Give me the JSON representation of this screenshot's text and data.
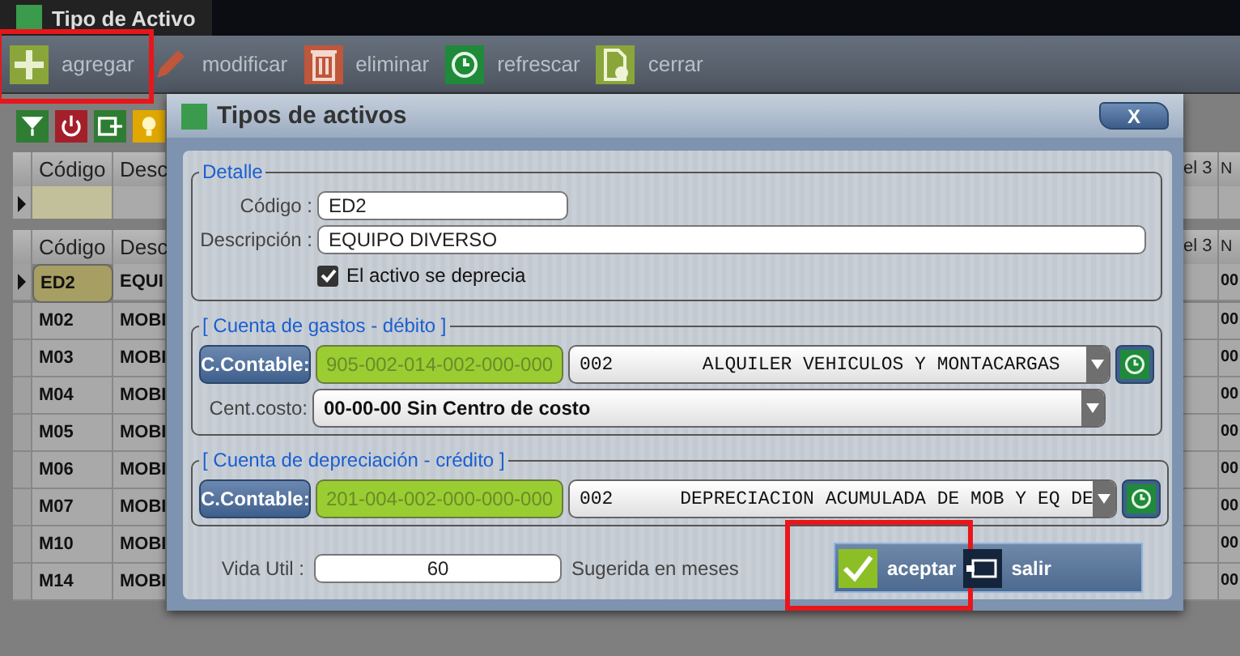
{
  "window": {
    "tab": "Tipo de Activo"
  },
  "toolbar": [
    {
      "kind": "add",
      "label": "agregar",
      "highlighted": true
    },
    {
      "kind": "edit",
      "label": "modificar",
      "highlighted": false
    },
    {
      "kind": "delete",
      "label": "eliminar",
      "highlighted": false
    },
    {
      "kind": "refresh",
      "label": "refrescar",
      "highlighted": false
    },
    {
      "kind": "close",
      "label": "cerrar",
      "highlighted": false
    }
  ],
  "grid_tools": [
    {
      "kind": "filter"
    },
    {
      "kind": "power"
    },
    {
      "kind": "export"
    },
    {
      "kind": "bulb"
    }
  ],
  "filter_header": [
    "Código",
    "Desc",
    "el 3",
    "N"
  ],
  "grid": {
    "columns": [
      "Código",
      "Desc",
      "el 3",
      "N"
    ],
    "rows": [
      {
        "code": "ED2",
        "desc": "EQUI",
        "col_4": "00",
        "selected": true
      },
      {
        "code": "M02",
        "desc": "MOBI",
        "col_4": "00",
        "selected": false
      },
      {
        "code": "M03",
        "desc": "MOBI",
        "col_4": "00",
        "selected": false
      },
      {
        "code": "M04",
        "desc": "MOBI",
        "col_4": "00",
        "selected": false
      },
      {
        "code": "M05",
        "desc": "MOBI",
        "col_4": "00",
        "selected": false
      },
      {
        "code": "M06",
        "desc": "MOBI",
        "col_4": "00",
        "selected": false
      },
      {
        "code": "M07",
        "desc": "MOBI",
        "col_4": "00",
        "selected": false
      },
      {
        "code": "M10",
        "desc": "MOBI",
        "col_4": "00",
        "selected": false
      },
      {
        "code": "M14",
        "desc": "MOBI",
        "col_4": "00",
        "selected": false
      }
    ]
  },
  "dialog": {
    "title": "Tipos de activos",
    "close": "X",
    "detalle": {
      "legend": "Detalle",
      "codigo_label": "Código :",
      "codigo": "ED2",
      "descripcion_label": "Descripción :",
      "descripcion": "EQUIPO DIVERSO",
      "deprecia_label": "El activo se deprecia",
      "deprecia": true
    },
    "accounts": [
      {
        "legend": "[ Cuenta de gastos - débito ]",
        "button": "C.Contable:",
        "account": "905-002-014-002-000-000",
        "select": "002        ALQUILER VEHICULOS Y MONTACARGAS",
        "cost_label": "Cent.costo:",
        "cost_center": "00-00-00 Sin Centro de costo"
      },
      {
        "legend": "[ Cuenta de depreciación - crédito ]",
        "button": "C.Contable:",
        "account": "201-004-002-000-000-000",
        "select": "002      DEPRECIACION ACUMULADA DE MOB Y EQ DE"
      }
    ],
    "vida_label": "Vida Util :",
    "vida": "60",
    "vida_hint": "Sugerida en meses",
    "buttons": [
      {
        "kind": "accept",
        "label": "aceptar",
        "highlighted": true
      },
      {
        "kind": "exit",
        "label": "salir",
        "highlighted": false
      }
    ]
  }
}
